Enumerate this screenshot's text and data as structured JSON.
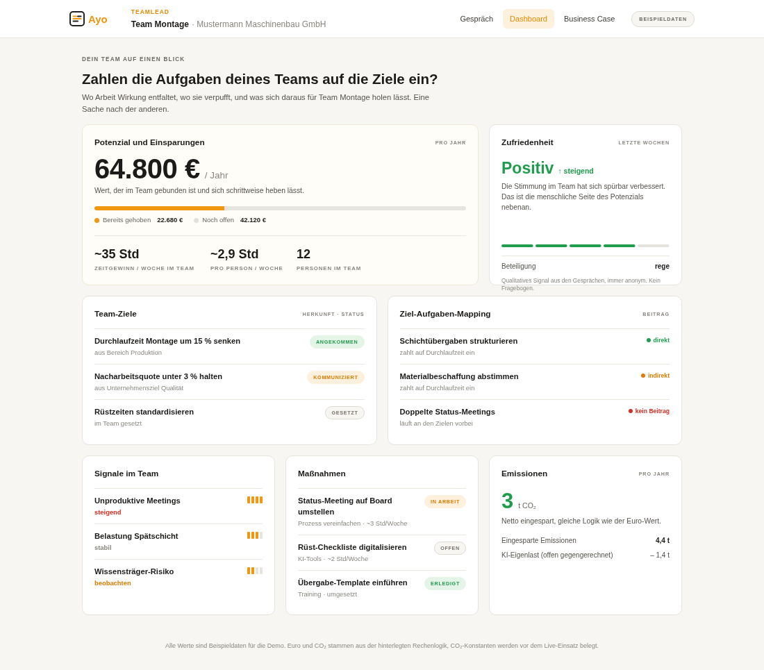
{
  "header": {
    "logo": "Ayo",
    "role": "TEAMLEAD",
    "team": "Team Montage",
    "company": "· Mustermann Maschinenbau GmbH",
    "nav": [
      {
        "label": "Gespräch",
        "selected": false
      },
      {
        "label": "Dashboard",
        "selected": true
      },
      {
        "label": "Business Case",
        "selected": false
      }
    ],
    "badge": "BEISPIELDATEN"
  },
  "intro": {
    "eyebrow": "DEIN TEAM AUF EINEN BLICK",
    "title": "Zahlen die Aufgaben deines Teams auf die Ziele ein?",
    "text": "Wo Arbeit Wirkung entfaltet, wo sie verpufft, und was sich daraus für Team Montage holen lässt. Eine Sache nach der anderen."
  },
  "potential": {
    "title": "Potenzial und Einsparungen",
    "period": "PRO JAHR",
    "amount": "64.800 €",
    "unit": "/ Jahr",
    "caption": "Wert, der im Team gebunden ist und sich schrittweise heben lässt.",
    "level": 0.35,
    "legend": [
      {
        "label": "Bereits gehoben",
        "value": "22.680 €",
        "color": "#f0960f"
      },
      {
        "label": "Noch offen",
        "value": "42.120 €",
        "color": "#e3e1dc"
      }
    ],
    "stats": [
      {
        "value": "~35 Std",
        "label": "ZEITGEWINN / WOCHE IM TEAM"
      },
      {
        "value": "~2,9 Std",
        "label": "PRO PERSON / WOCHE"
      },
      {
        "value": "12",
        "label": "PERSONEN IM TEAM"
      }
    ]
  },
  "satisfaction": {
    "title": "Zufriedenheit",
    "period": "LETZTE WOCHEN",
    "mood": "Positiv",
    "trend": "↑ steigend",
    "text": "Die Stimmung im Team hat sich spürbar verbessert. Das ist die menschliche Seite des Potenzials nebenan.",
    "level": 0.8,
    "participation_label": "Beteiligung",
    "participation_value": "rege",
    "note": "Qualitatives Signal aus den Gesprächen, immer anonym. Kein Fragebogen."
  },
  "goals": {
    "title": "Team-Ziele",
    "meta": "HERKUNFT · STATUS",
    "items": [
      {
        "title": "Durchlaufzeit Montage um 15 % senken",
        "source": "aus Bereich Produktion",
        "status": "ANGEKOMMEN",
        "kind": "positive"
      },
      {
        "title": "Nacharbeitsquote unter 3 % halten",
        "source": "aus Unternehmensziel Qualität",
        "status": "KOMMUNIZIERT",
        "kind": "progress"
      },
      {
        "title": "Rüstzeiten standardisieren",
        "source": "im Team gesetzt",
        "status": "GESETZT",
        "kind": "neutral"
      }
    ]
  },
  "mapping": {
    "title": "Ziel-Aufgaben-Mapping",
    "meta": "BEITRAG",
    "items": [
      {
        "title": "Schichtübergaben strukturieren",
        "note": "zahlt auf Durchlaufzeit ein",
        "contribution": "direkt",
        "color": "#1f9d4c"
      },
      {
        "title": "Materialbeschaffung abstimmen",
        "note": "zahlt auf Durchlaufzeit ein",
        "contribution": "indirekt",
        "color": "#e07b00"
      },
      {
        "title": "Doppelte Status-Meetings",
        "note": "läuft an den Zielen vorbei",
        "contribution": "kein Beitrag",
        "color": "#d92d20"
      }
    ]
  },
  "signals": {
    "title": "Signale im Team",
    "items": [
      {
        "title": "Unproduktive Meetings",
        "trend": "steigend",
        "color": "#d92d20",
        "level": 1
      },
      {
        "title": "Belastung Spätschicht",
        "trend": "stabil",
        "color": "#8a8780",
        "level": 0.75
      },
      {
        "title": "Wissensträger-Risiko",
        "trend": "beobachten",
        "color": "#e07b00",
        "level": 0.5
      }
    ]
  },
  "measures": {
    "title": "Maßnahmen",
    "items": [
      {
        "title": "Status-Meeting auf Board umstellen",
        "meta": "Prozess vereinfachen · ~3 Std/Woche",
        "status": "IN ARBEIT",
        "kind": "progress"
      },
      {
        "title": "Rüst-Checkliste digitalisieren",
        "meta": "KI-Tools · ~2 Std/Woche",
        "status": "OFFEN",
        "kind": "neutral"
      },
      {
        "title": "Übergabe-Template einführen",
        "meta": "Training · umgesetzt",
        "status": "ERLEDIGT",
        "kind": "positive"
      }
    ]
  },
  "emissions": {
    "title": "Emissionen",
    "period": "PRO JAHR",
    "amount": "3",
    "unit": "t CO₂",
    "caption": "Netto eingespart, gleiche Logik wie der Euro-Wert.",
    "rows": [
      {
        "label": "Eingesparte Emissionen",
        "value": "4,4 t",
        "kind": "total"
      },
      {
        "label": "KI-Eigenlast (offen gegengerechnet)",
        "value": "– 1,4 t",
        "kind": "offset"
      }
    ]
  },
  "footer": "Alle Werte sind Beispieldaten für die Demo. Euro und CO₂ stammen aus der hinterlegten Rechenlogik, CO₂-Konstanten werden vor dem Live-Einsatz belegt."
}
